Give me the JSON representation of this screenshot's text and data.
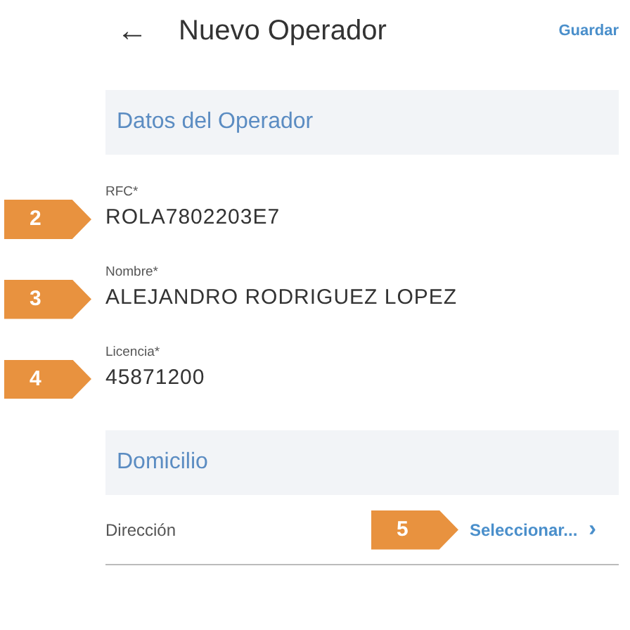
{
  "header": {
    "back": "←",
    "title": "Nuevo Operador",
    "action": "Guardar"
  },
  "sections": [
    {
      "title": "Datos del Operador",
      "fields": [
        {
          "kind": "text",
          "label": "RFC*",
          "value": "ROLA7802203E7",
          "callout": "2"
        },
        {
          "kind": "text",
          "label": "Nombre*",
          "value": "ALEJANDRO RODRIGUEZ LOPEZ",
          "callout": "3"
        },
        {
          "kind": "text",
          "label": "Licencia*",
          "value": "45871200",
          "callout": "4"
        }
      ]
    },
    {
      "title": "Domicilio",
      "fields": [
        {
          "kind": "select",
          "label": "Dirección",
          "value": "Seleccionar...",
          "chevron": "›",
          "callout": "5"
        }
      ]
    }
  ]
}
